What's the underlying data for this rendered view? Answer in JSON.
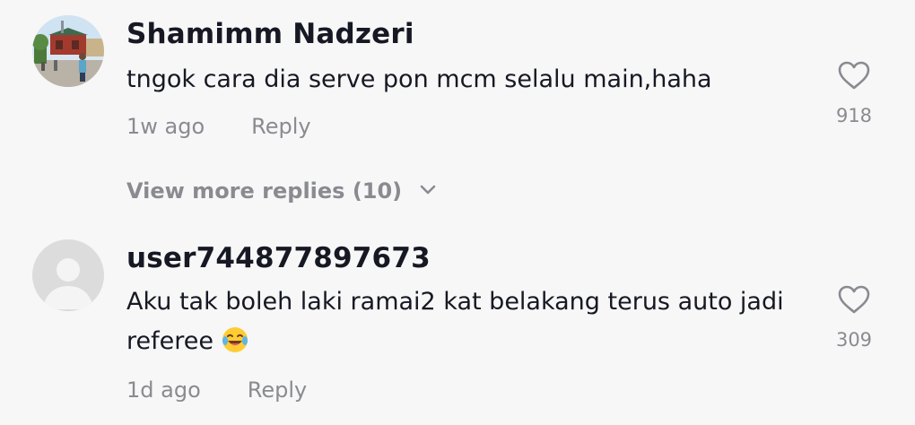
{
  "comments": [
    {
      "username": "Shamimm Nadzeri",
      "text": "tngok cara dia serve pon mcm selalu main,haha",
      "time": "1w ago",
      "reply_label": "Reply",
      "likes": "918",
      "avatar": "photo-avatar",
      "view_more": "View more replies (10)"
    },
    {
      "username": "user744877897673",
      "text": "Aku tak boleh laki ramai2 kat belakang terus auto jadi referee",
      "emoji": "laughing-tears-emoji",
      "time": "1d ago",
      "reply_label": "Reply",
      "likes": "309",
      "avatar": "default-avatar"
    }
  ],
  "colors": {
    "background": "#f7f7f7",
    "primary_text": "#161823",
    "secondary_text": "#8a8b91"
  }
}
